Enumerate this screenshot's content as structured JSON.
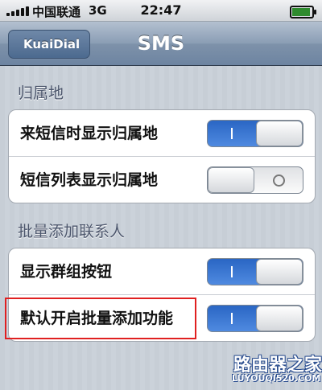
{
  "status_bar": {
    "carrier": "中国联通",
    "network": "3G",
    "time": "22:47"
  },
  "nav": {
    "back_label": "KuaiDial",
    "title": "SMS"
  },
  "sections": [
    {
      "header": "归属地",
      "rows": [
        {
          "label": "来短信时显示归属地",
          "state": "on"
        },
        {
          "label": "短信列表显示归属地",
          "state": "off"
        }
      ]
    },
    {
      "header": "批量添加联系人",
      "rows": [
        {
          "label": "显示群组按钮",
          "state": "on"
        },
        {
          "label": "默认开启批量添加功能",
          "state": "on"
        }
      ]
    }
  ],
  "watermark": {
    "text": "路由器之家",
    "url": "LUYOUQI520.COM"
  },
  "colors": {
    "switch_on": "#3a75d4",
    "nav_bar": "#7e92aa",
    "highlight_box": "#e02020"
  }
}
